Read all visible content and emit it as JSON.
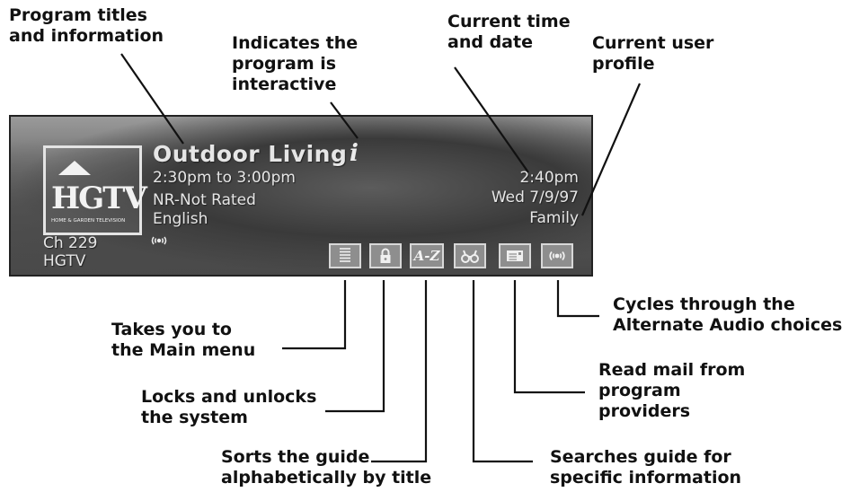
{
  "callouts": {
    "program_titles": "Program titles\nand information",
    "interactive": "Indicates the\nprogram is\ninteractive",
    "time_date": "Current time\nand date",
    "user_profile": "Current user\nprofile",
    "main_menu": "Takes you to\nthe Main menu",
    "locks": "Locks and unlocks\nthe system",
    "sorts": "Sorts the guide\nalphabetically by title",
    "searches": "Searches guide for\nspecific information",
    "mail": "Read mail from\nprogram\nproviders",
    "audio": "Cycles through the\nAlternate Audio choices"
  },
  "banner": {
    "title": "Outdoor Living",
    "time_range": "2:30pm to 3:00pm",
    "rating": "NR-Not Rated",
    "language": "English",
    "current_time": "2:40pm",
    "current_date": "Wed 7/9/97",
    "profile": "Family",
    "channel_number": "Ch 229",
    "channel_name": "HGTV",
    "logo_text": "HGTV",
    "logo_subtext": "HOME & GARDEN TELEVISION"
  },
  "buttons": {
    "sort_label": "A-Z"
  },
  "icons": [
    "interactive-i-icon",
    "alternate-audio-icon",
    "main-menu-icon",
    "lock-icon",
    "sort-az-icon",
    "binoculars-icon",
    "mail-icon",
    "audio-cycle-icon"
  ],
  "colors": {
    "banner_text": "#e6e6e6",
    "button_face": "#8e8e8e",
    "callout_text": "#111111"
  }
}
